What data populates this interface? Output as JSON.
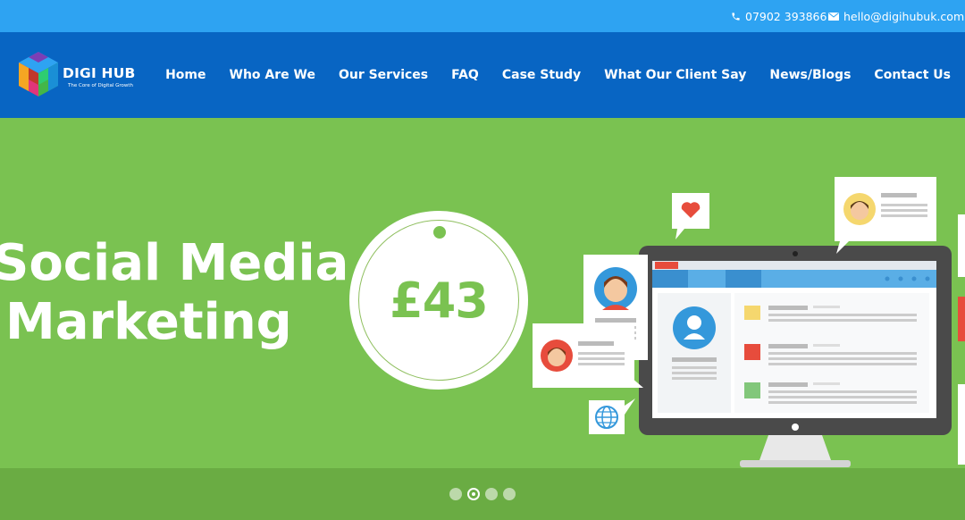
{
  "topbar": {
    "phone": "07902 393866",
    "email": "hello@digihubuk.com"
  },
  "header": {
    "logo_text": "DIGI HUB",
    "logo_tagline": "The Core of Digital Growth",
    "nav": [
      {
        "label": "Home"
      },
      {
        "label": "Who Are We"
      },
      {
        "label": "Our Services"
      },
      {
        "label": "FAQ"
      },
      {
        "label": "Case Study"
      },
      {
        "label": "What Our Client Say"
      },
      {
        "label": "News/Blogs"
      },
      {
        "label": "Contact Us"
      }
    ]
  },
  "hero": {
    "headline_line1": "Social Media",
    "headline_line2": "Marketing",
    "price": "£43"
  },
  "slider": {
    "total_slides": 4,
    "active_slide": 2
  },
  "colors": {
    "topbar": "#2ea3f2",
    "header": "#0865c3",
    "hero_bg": "#7ac251",
    "slider_bar": "#6aac43",
    "price_text": "#7ac251"
  }
}
